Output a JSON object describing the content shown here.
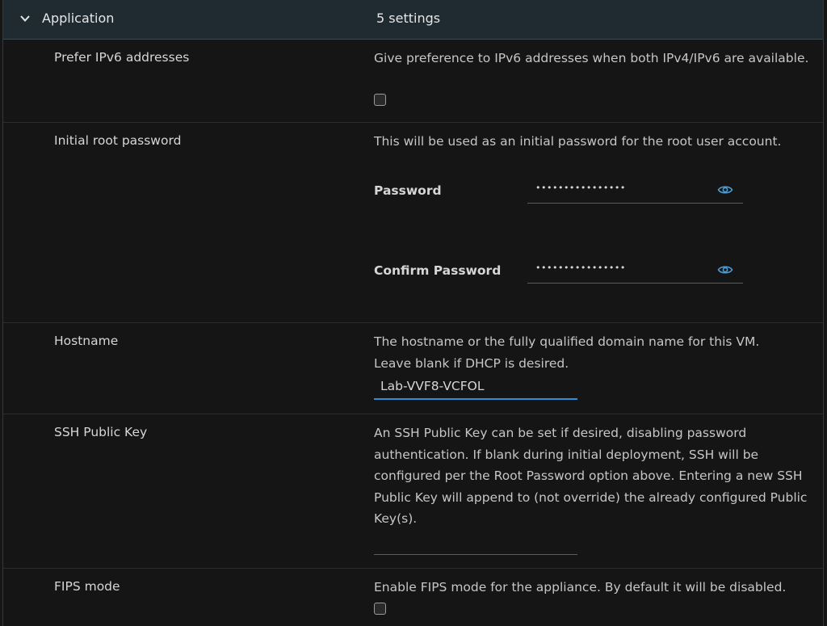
{
  "section": {
    "title": "Application",
    "count": "5 settings"
  },
  "rows": {
    "ipv6": {
      "label": "Prefer IPv6 addresses",
      "description": "Give preference to IPv6 addresses when both IPv4/IPv6 are available.",
      "checked": false
    },
    "root_password": {
      "label": "Initial root password",
      "description": "This will be used as an initial password for the root user account.",
      "password_label": "Password",
      "password_value": "••••••••••••••••",
      "confirm_label": "Confirm Password",
      "confirm_value": "••••••••••••••••"
    },
    "hostname": {
      "label": "Hostname",
      "description": "The hostname or the fully qualified domain name for this VM. Leave blank if DHCP is desired.",
      "value": "Lab-VVF8-VCFOL"
    },
    "ssh": {
      "label": "SSH Public Key",
      "description": "An SSH Public Key can be set if desired, disabling password authentication. If blank during initial deployment, SSH will be configured per the Root Password option above. Entering a new SSH Public Key will append to (not override) the already configured Public Key(s).",
      "value": ""
    },
    "fips": {
      "label": "FIPS mode",
      "description": "Enable FIPS mode for the appliance. By default it will be disabled.",
      "checked": false
    }
  },
  "colors": {
    "accent": "#2f8ed8",
    "eye_icon": "#4a9fd8",
    "header_bg": "#1f2b30"
  },
  "icons": {
    "collapse": "chevron-down-icon",
    "reveal": "eye-icon"
  }
}
